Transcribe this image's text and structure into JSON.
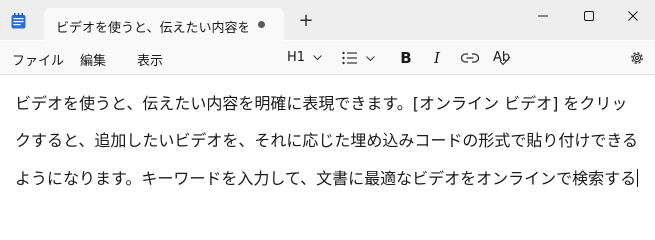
{
  "window": {
    "tab_title": "ビデオを使うと、伝えたい内容を明確に表",
    "new_tab_label": "+"
  },
  "menu": {
    "file": "ファイル",
    "edit": "編集",
    "view": "表示"
  },
  "toolbar": {
    "heading": "H1",
    "bold": "B",
    "italic": "I",
    "spell": "Ab"
  },
  "document": {
    "lines": [
      "ビデオを使うと、伝えたい内容を明確に表現できます。[オンライン ビデオ] をクリッ",
      "クすると、追加したいビデオを、それに応じた埋め込みコードの形式で貼り付けできる",
      "ようになります。キーワードを入力して、文書に最適なビデオをオンラインで検索する"
    ]
  },
  "colors": {
    "titlebar": "#eeeeee",
    "tab": "#f9f9f9",
    "editor": "#ffffff",
    "app_icon": "#2b6fd6"
  }
}
